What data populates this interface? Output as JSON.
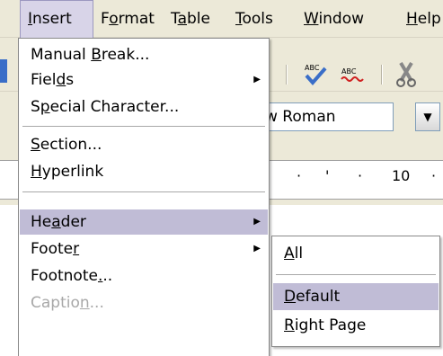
{
  "menubar": {
    "items": [
      {
        "pre": "",
        "u": "I",
        "post": "nsert"
      },
      {
        "pre": "F",
        "u": "o",
        "post": "rmat"
      },
      {
        "pre": "T",
        "u": "a",
        "post": "ble"
      },
      {
        "pre": "",
        "u": "T",
        "post": "ools"
      },
      {
        "pre": "",
        "u": "W",
        "post": "indow"
      },
      {
        "pre": "",
        "u": "H",
        "post": "elp"
      }
    ]
  },
  "toolbar": {
    "font_name": "w Roman",
    "ruler_label": "10"
  },
  "insert_menu": {
    "items": [
      {
        "pre": "Manual ",
        "u": "B",
        "post": "reak..."
      },
      {
        "pre": "Fiel",
        "u": "d",
        "post": "s"
      },
      {
        "pre": "S",
        "u": "p",
        "post": "ecial Character..."
      },
      {
        "pre": "",
        "u": "S",
        "post": "ection..."
      },
      {
        "pre": "",
        "u": "H",
        "post": "yperlink"
      },
      {
        "pre": "He",
        "u": "a",
        "post": "der"
      },
      {
        "pre": "Foote",
        "u": "r",
        "post": ""
      },
      {
        "pre": "Footnote",
        "u": ".",
        "post": ".."
      },
      {
        "pre": "Captio",
        "u": "n",
        "post": "..."
      }
    ]
  },
  "header_submenu": {
    "items": [
      {
        "pre": "",
        "u": "A",
        "post": "ll"
      },
      {
        "pre": "",
        "u": "D",
        "post": "efault"
      },
      {
        "pre": "",
        "u": "R",
        "post": "ight Page"
      }
    ]
  }
}
